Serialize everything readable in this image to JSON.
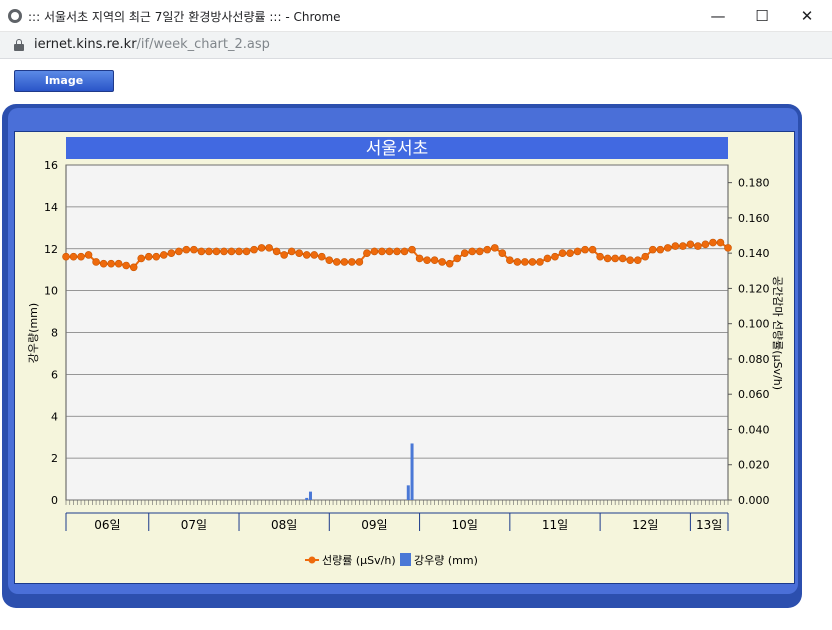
{
  "window": {
    "title": "::: 서울서초 지역의 최근 7일간 환경방사선량률 ::: - Chrome",
    "minimize_icon": "minimize-icon",
    "maximize_icon": "maximize-icon",
    "close_icon": "close-icon"
  },
  "address": {
    "host": "iernet.kins.re.kr",
    "path": "/if/week_chart_2.asp"
  },
  "toolbar": {
    "image_button": "Image"
  },
  "colors": {
    "dose": "#ee6a0c",
    "rain": "#4a78d6",
    "title_bar": "#4169e1",
    "panel": "#f5f5dc",
    "frame": "#4a6fd8"
  },
  "chart_data": {
    "type": "line+bar",
    "title": "서울서초",
    "left_axis": {
      "label": "강우량(mm)",
      "range": [
        0,
        16
      ],
      "ticks": [
        "0",
        "2",
        "4",
        "6",
        "8",
        "10",
        "12",
        "14",
        "16"
      ]
    },
    "right_axis": {
      "label": "공간감마 선량률(μSv/h)",
      "range": [
        0,
        0.19
      ],
      "ticks": [
        "0.000",
        "0.020",
        "0.040",
        "0.060",
        "0.080",
        "0.100",
        "0.120",
        "0.140",
        "0.160",
        "0.180"
      ]
    },
    "x_axis": {
      "days": [
        "06일",
        "07일",
        "08일",
        "09일",
        "10일",
        "11일",
        "12일",
        "13일"
      ],
      "day_start_hours": [
        0,
        22,
        46,
        70,
        94,
        118,
        142,
        166
      ],
      "total_hours": 176
    },
    "grid": true,
    "legend": {
      "position": "bottom",
      "dose_label": "선량률 (μSv/h)",
      "rain_label": "강우량 (mm)"
    },
    "series": [
      {
        "name": "선량률 (μSv/h)",
        "axis": "right",
        "kind": "line",
        "hours": [
          0,
          2,
          4,
          6,
          8,
          10,
          12,
          14,
          16,
          18,
          20,
          22,
          24,
          26,
          28,
          30,
          32,
          34,
          36,
          38,
          40,
          42,
          44,
          46,
          48,
          50,
          52,
          54,
          56,
          58,
          60,
          62,
          64,
          66,
          68,
          70,
          72,
          74,
          76,
          78,
          80,
          82,
          84,
          86,
          88,
          90,
          92,
          94,
          96,
          98,
          100,
          102,
          104,
          106,
          108,
          110,
          112,
          114,
          116,
          118,
          120,
          122,
          124,
          126,
          128,
          130,
          132,
          134,
          136,
          138,
          140,
          142,
          144,
          146,
          148,
          150,
          152,
          154,
          156,
          158,
          160,
          162,
          164,
          166,
          168,
          170,
          172,
          174,
          176
        ],
        "values": [
          0.138,
          0.138,
          0.138,
          0.139,
          0.135,
          0.134,
          0.134,
          0.134,
          0.133,
          0.132,
          0.137,
          0.138,
          0.138,
          0.139,
          0.14,
          0.141,
          0.142,
          0.142,
          0.141,
          0.141,
          0.141,
          0.141,
          0.141,
          0.141,
          0.141,
          0.142,
          0.143,
          0.143,
          0.141,
          0.139,
          0.141,
          0.14,
          0.139,
          0.139,
          0.138,
          0.136,
          0.135,
          0.135,
          0.135,
          0.135,
          0.14,
          0.141,
          0.141,
          0.141,
          0.141,
          0.141,
          0.142,
          0.137,
          0.136,
          0.136,
          0.135,
          0.134,
          0.137,
          0.14,
          0.141,
          0.141,
          0.142,
          0.143,
          0.14,
          0.136,
          0.135,
          0.135,
          0.135,
          0.135,
          0.137,
          0.138,
          0.14,
          0.14,
          0.141,
          0.142,
          0.142,
          0.138,
          0.137,
          0.137,
          0.137,
          0.136,
          0.136,
          0.138,
          0.142,
          0.142,
          0.143,
          0.144,
          0.144,
          0.145,
          0.144,
          0.145,
          0.146,
          0.146,
          0.143
        ]
      },
      {
        "name": "강우량 (mm)",
        "axis": "left",
        "kind": "bar",
        "hours": [
          64,
          65,
          91,
          92
        ],
        "values": [
          0.1,
          0.4,
          0.7,
          2.7
        ]
      }
    ]
  }
}
